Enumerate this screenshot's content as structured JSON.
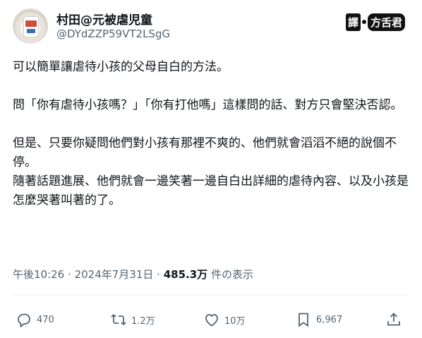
{
  "author": {
    "display_name": "村田@元被虐児童",
    "handle": "@DYdZZP59VT2LSgG"
  },
  "badge": {
    "left_text": "譯",
    "right_text": "方舌君"
  },
  "tweet": {
    "lines": [
      "可以簡單讓虐待小孩的父母自白的方法。",
      "",
      "問「你有虐待小孩嗎？」「你有打他嗎」這樣問的話、對方只會堅決否認。",
      "",
      "但是、只要你疑問他們對小孩有那裡不爽的、他們就會滔滔不絕的說個不停。",
      "隨著話題進展、他們就會一邊笑著一邊自白出詳細的虐待內容、以及小孩是怎麼哭著叫著的了。"
    ]
  },
  "meta": {
    "time": "午後10:26",
    "separator": "·",
    "date": "2024年7月31日",
    "views_count": "485.3万",
    "views_label": "件の表示"
  },
  "actions": {
    "reply_count": "470",
    "retweet_count": "1.2万",
    "like_count": "10万",
    "bookmark_count": "6,967"
  }
}
